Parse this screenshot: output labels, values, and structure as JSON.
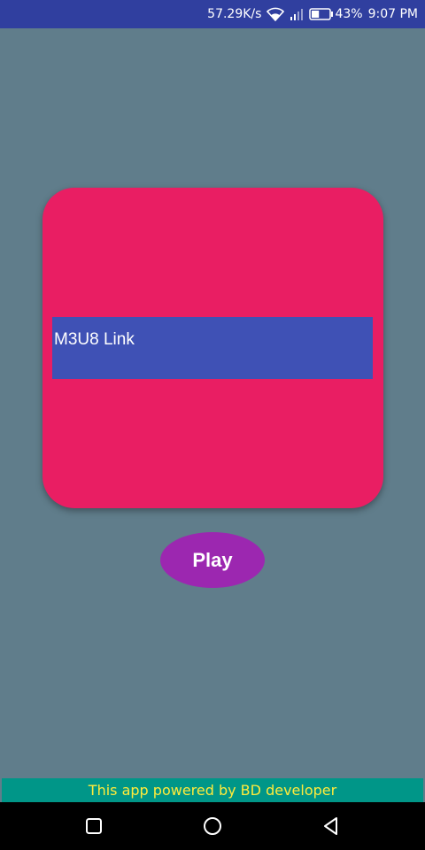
{
  "status_bar": {
    "network_speed": "57.29K/s",
    "battery_percent": "43%",
    "battery_level": 43,
    "time": "9:07 PM",
    "icons": [
      "wifi-icon",
      "signal-icon",
      "battery-icon"
    ]
  },
  "card": {
    "link_placeholder": "M3U8 Link"
  },
  "play_button": {
    "label": "Play"
  },
  "footer": {
    "text": "This app powered by BD developer"
  },
  "nav_bar": {
    "icons": [
      "recent-apps-icon",
      "home-icon",
      "back-icon"
    ]
  },
  "colors": {
    "background": "#607D8B",
    "status_bar": "#303F9F",
    "card": "#E91E63",
    "input": "#3F51B5",
    "play_button": "#9C27B0",
    "footer": "#009688",
    "footer_text": "#FFEB3B"
  }
}
